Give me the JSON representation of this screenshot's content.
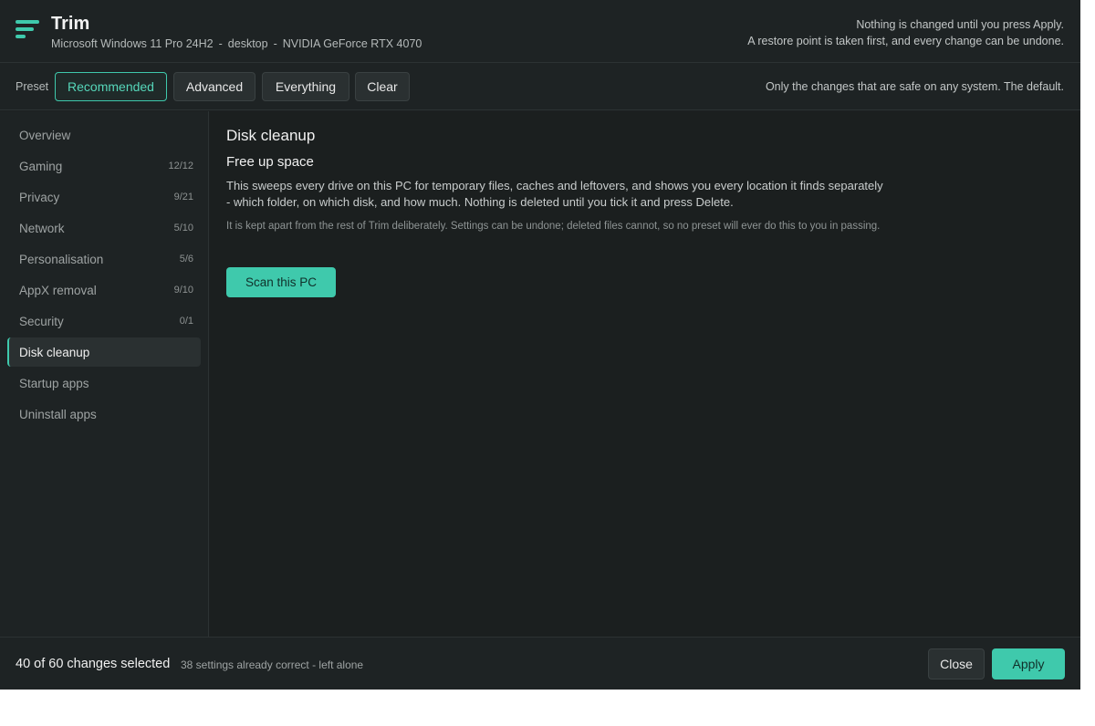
{
  "app": {
    "title": "Trim",
    "icon": "menu-lines-icon",
    "accent_color": "#3fc9ac",
    "system": {
      "os": "Microsoft Windows 11 Pro 24H2",
      "separator": "-",
      "device_type": "desktop",
      "gpu": "NVIDIA GeForce RTX 4070"
    },
    "note_line1": "Nothing is changed until you press Apply.",
    "note_line2": "A restore point is taken first, and every change can be undone."
  },
  "preset": {
    "label": "Preset",
    "options": [
      "Recommended",
      "Advanced",
      "Everything",
      "Clear"
    ],
    "selected": "Recommended",
    "description": "Only the changes that are safe on any system. The default."
  },
  "sidebar": {
    "items": [
      {
        "label": "Overview",
        "count": ""
      },
      {
        "label": "Gaming",
        "count": "12/12"
      },
      {
        "label": "Privacy",
        "count": "9/21"
      },
      {
        "label": "Network",
        "count": "5/10"
      },
      {
        "label": "Personalisation",
        "count": "5/6"
      },
      {
        "label": "AppX removal",
        "count": "9/10"
      },
      {
        "label": "Security",
        "count": "0/1"
      },
      {
        "label": "Disk cleanup",
        "count": ""
      },
      {
        "label": "Startup apps",
        "count": ""
      },
      {
        "label": "Uninstall apps",
        "count": ""
      }
    ],
    "active": "Disk cleanup"
  },
  "main": {
    "title": "Disk cleanup",
    "section_title": "Free up space",
    "body": "This sweeps every drive on this PC for temporary files, caches and leftovers, and shows you every location it finds separately - which folder, on which disk, and how much. Nothing is deleted until you tick it and press Delete.",
    "note": "It is kept apart from the rest of Trim deliberately. Settings can be undone; deleted files cannot, so no preset will ever do this to you in passing.",
    "scan_button": "Scan this PC"
  },
  "footer": {
    "selected_count": "40 of 60 changes selected",
    "note": "38 settings already correct - left alone",
    "close_label": "Close",
    "apply_label": "Apply"
  }
}
